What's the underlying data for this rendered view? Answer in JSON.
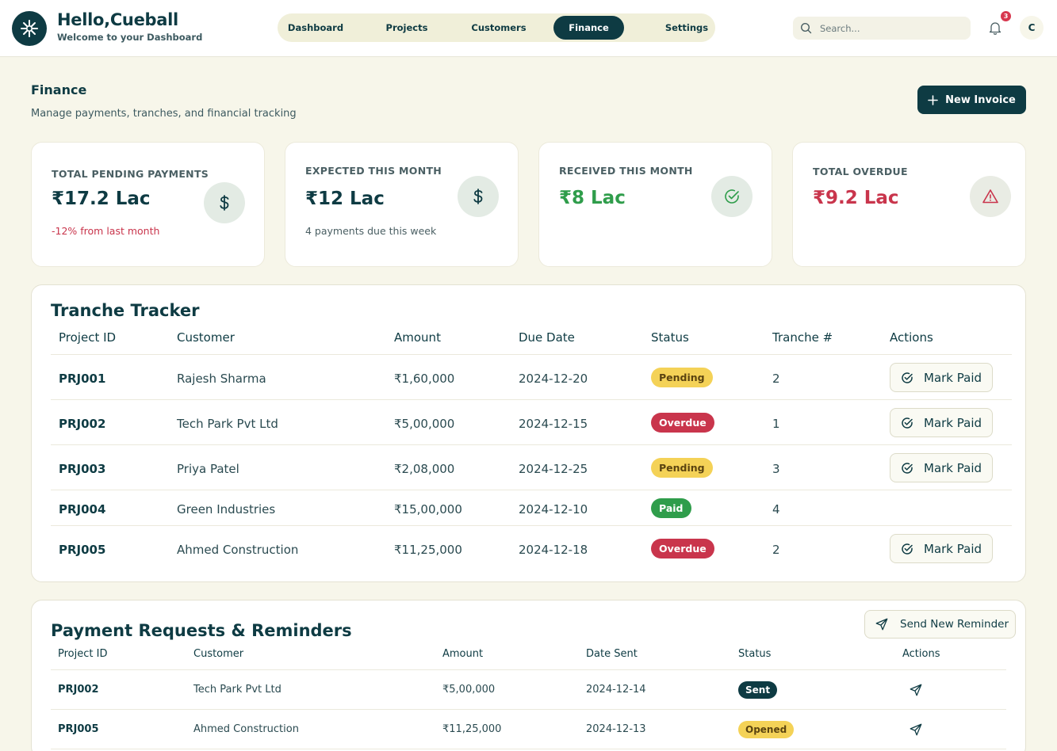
{
  "header": {
    "greeting": "Hello,Cueball",
    "subtitle": "Welcome to your Dashboard",
    "nav": [
      "Dashboard",
      "Projects",
      "Customers",
      "Finance",
      "Settings"
    ],
    "active_nav": "Finance",
    "search_placeholder": "Search...",
    "notification_count": "3",
    "avatar_initial": "C"
  },
  "page": {
    "title": "Finance",
    "subtitle": "Manage payments, tranches, and financial tracking",
    "new_invoice_label": "New Invoice"
  },
  "stats": [
    {
      "label": "TOTAL PENDING PAYMENTS",
      "value": "₹17.2 Lac",
      "note": "-12% from last month",
      "icon": "dollar-icon"
    },
    {
      "label": "EXPECTED THIS MONTH",
      "value": "₹12 Lac",
      "note": "4 payments due this week",
      "icon": "dollar-icon"
    },
    {
      "label": "RECEIVED THIS MONTH",
      "value": "₹8 Lac",
      "note": "",
      "icon": "check-circle-icon"
    },
    {
      "label": "TOTAL OVERDUE",
      "value": "₹9.2 Lac",
      "note": "",
      "icon": "warning-icon"
    }
  ],
  "colors": {
    "primary": "#0e3b43",
    "background": "#f7f6ea",
    "positive": "#2f9d4b",
    "negative": "#c9354c",
    "warning": "#f4d257"
  },
  "tranche": {
    "title": "Tranche Tracker",
    "columns": [
      "Project ID",
      "Customer",
      "Amount",
      "Due Date",
      "Status",
      "Tranche #",
      "Actions"
    ],
    "action_label": "Mark Paid",
    "rows": [
      {
        "id": "PRJ001",
        "customer": "Rajesh Sharma",
        "amount": "₹1,60,000",
        "due": "2024-12-20",
        "status": "Pending",
        "tranche": "2"
      },
      {
        "id": "PRJ002",
        "customer": "Tech Park Pvt Ltd",
        "amount": "₹5,00,000",
        "due": "2024-12-15",
        "status": "Overdue",
        "tranche": "1"
      },
      {
        "id": "PRJ003",
        "customer": "Priya Patel",
        "amount": "₹2,08,000",
        "due": "2024-12-25",
        "status": "Pending",
        "tranche": "3"
      },
      {
        "id": "PRJ004",
        "customer": "Green Industries",
        "amount": "₹15,00,000",
        "due": "2024-12-10",
        "status": "Paid",
        "tranche": "4"
      },
      {
        "id": "PRJ005",
        "customer": "Ahmed Construction",
        "amount": "₹11,25,000",
        "due": "2024-12-18",
        "status": "Overdue",
        "tranche": "2"
      }
    ]
  },
  "reminders": {
    "title": "Payment Requests & Reminders",
    "send_label": "Send New Reminder",
    "columns": [
      "Project ID",
      "Customer",
      "Amount",
      "Date Sent",
      "Status",
      "Actions"
    ],
    "rows": [
      {
        "id": "PRJ002",
        "customer": "Tech Park Pvt Ltd",
        "amount": "₹5,00,000",
        "date": "2024-12-14",
        "status": "Sent"
      },
      {
        "id": "PRJ005",
        "customer": "Ahmed Construction",
        "amount": "₹11,25,000",
        "date": "2024-12-13",
        "status": "Opened"
      }
    ]
  }
}
